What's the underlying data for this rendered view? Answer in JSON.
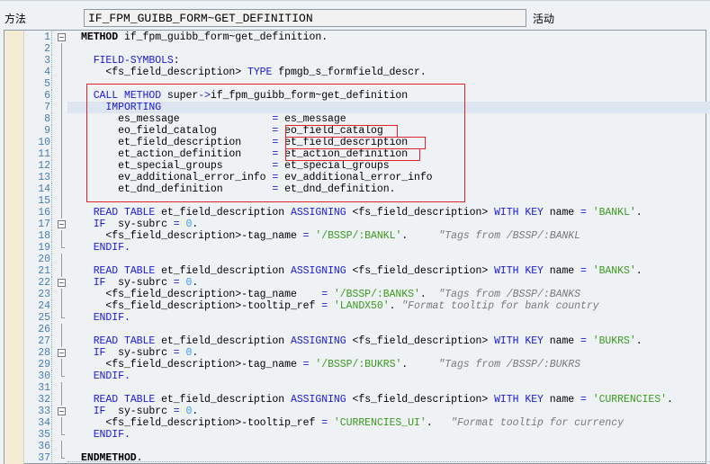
{
  "header": {
    "method_label": "方法",
    "method_value": "IF_FPM_GUIBB_FORM~GET_DEFINITION",
    "status": "活动"
  },
  "colors": {
    "keyword": "#1a1adb",
    "string": "#3c9a1e",
    "comment": "#7a7a7a",
    "number": "#3399ff",
    "highlight_box": "#e0242a"
  },
  "editor": {
    "current_line": 7,
    "highlight_boxes": [
      {
        "lines": "6-14",
        "label": "call-method-block"
      },
      {
        "lines": "9",
        "label": "eo_field_catalog"
      },
      {
        "lines": "10",
        "label": "et_field_description"
      },
      {
        "lines": "11",
        "label": "et_action_definition"
      }
    ],
    "lines": [
      {
        "n": 1,
        "text": "METHOD if_fpm_guibb_form~get_definition.",
        "fold": "open"
      },
      {
        "n": 2,
        "text": ""
      },
      {
        "n": 3,
        "text": "  FIELD-SYMBOLS:"
      },
      {
        "n": 4,
        "text": "    <fs_field_description> TYPE fpmgb_s_formfield_descr."
      },
      {
        "n": 5,
        "text": ""
      },
      {
        "n": 6,
        "text": "  CALL METHOD super->if_fpm_guibb_form~get_definition"
      },
      {
        "n": 7,
        "text": "    IMPORTING"
      },
      {
        "n": 8,
        "text": "      es_message               = es_message"
      },
      {
        "n": 9,
        "text": "      eo_field_catalog         = eo_field_catalog"
      },
      {
        "n": 10,
        "text": "      et_field_description     = et_field_description"
      },
      {
        "n": 11,
        "text": "      et_action_definition     = et_action_definition"
      },
      {
        "n": 12,
        "text": "      et_special_groups        = et_special_groups"
      },
      {
        "n": 13,
        "text": "      ev_additional_error_info = ev_additional_error_info"
      },
      {
        "n": 14,
        "text": "      et_dnd_definition        = et_dnd_definition."
      },
      {
        "n": 15,
        "text": ""
      },
      {
        "n": 16,
        "text": "  READ TABLE et_field_description ASSIGNING <fs_field_description> WITH KEY name = 'BANKL'."
      },
      {
        "n": 17,
        "text": "  IF  sy-subrc = 0.",
        "fold": "open"
      },
      {
        "n": 18,
        "text": "    <fs_field_description>-tag_name = '/BSSP/:BANKL'.     \"Tags from /BSSP/:BANKL"
      },
      {
        "n": 19,
        "text": "  ENDIF.",
        "fold": "end"
      },
      {
        "n": 20,
        "text": ""
      },
      {
        "n": 21,
        "text": "  READ TABLE et_field_description ASSIGNING <fs_field_description> WITH KEY name = 'BANKS'."
      },
      {
        "n": 22,
        "text": "  IF  sy-subrc = 0.",
        "fold": "open"
      },
      {
        "n": 23,
        "text": "    <fs_field_description>-tag_name    = '/BSSP/:BANKS'.  \"Tags from /BSSP/:BANKS"
      },
      {
        "n": 24,
        "text": "    <fs_field_description>-tooltip_ref = 'LANDX50'. \"Format tooltip for bank country"
      },
      {
        "n": 25,
        "text": "  ENDIF.",
        "fold": "end"
      },
      {
        "n": 26,
        "text": ""
      },
      {
        "n": 27,
        "text": "  READ TABLE et_field_description ASSIGNING <fs_field_description> WITH KEY name = 'BUKRS'."
      },
      {
        "n": 28,
        "text": "  IF  sy-subrc = 0.",
        "fold": "open"
      },
      {
        "n": 29,
        "text": "    <fs_field_description>-tag_name = '/BSSP/:BUKRS'.     \"Tags from /BSSP/:BUKRS"
      },
      {
        "n": 30,
        "text": "  ENDIF.",
        "fold": "end"
      },
      {
        "n": 31,
        "text": ""
      },
      {
        "n": 32,
        "text": "  READ TABLE et_field_description ASSIGNING <fs_field_description> WITH KEY name = 'CURRENCIES'."
      },
      {
        "n": 33,
        "text": "  IF  sy-subrc = 0.",
        "fold": "open"
      },
      {
        "n": 34,
        "text": "    <fs_field_description>-tooltip_ref = 'CURRENCIES_UI'.   \"Format tooltip for currency"
      },
      {
        "n": 35,
        "text": "  ENDIF.",
        "fold": "end"
      },
      {
        "n": 36,
        "text": ""
      },
      {
        "n": 37,
        "text": "ENDMETHOD.",
        "fold": "close"
      }
    ]
  }
}
